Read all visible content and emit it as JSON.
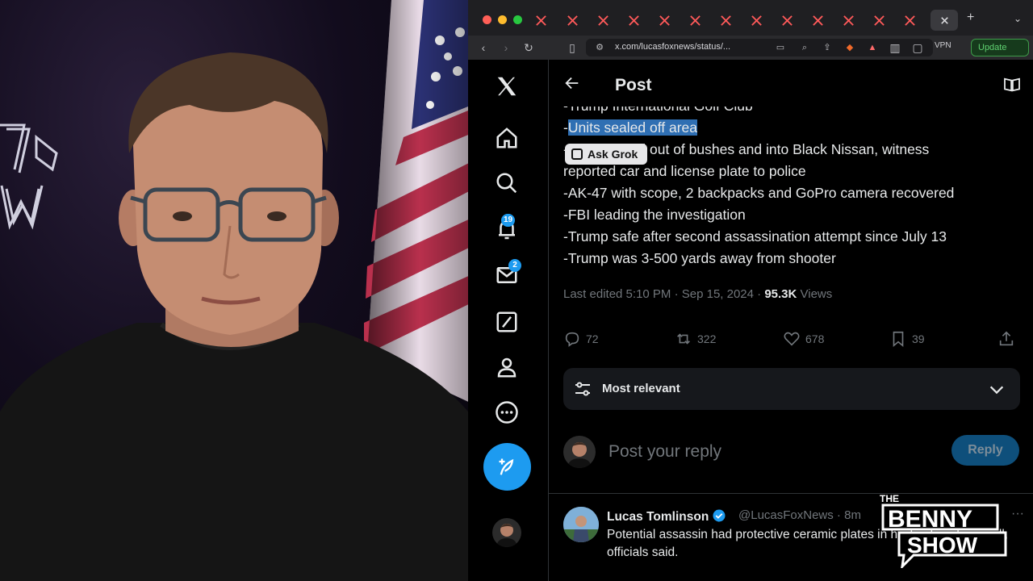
{
  "browser": {
    "url": "x.com/lucasfoxnews/status/...",
    "vpn_label": "VPN",
    "update_label": "Update"
  },
  "nav": {
    "notifications_badge": "19",
    "messages_badge": "2"
  },
  "post": {
    "header_title": "Post",
    "lines": [
      "-Trump International Golf Club",
      "-Units sealed off area",
      "-Suspect fled out of bushes and into Black Nissan, witness",
      "reported car and license plate to police",
      "-AK-47 with scope, 2 backpacks and GoPro camera recovered",
      "-FBI leading the investigation",
      "-Trump safe after second assassination attempt since July 13",
      "-Trump was 3-500 yards away from shooter"
    ],
    "highlighted_text": "Units sealed off area",
    "ask_grok_label": "Ask Grok",
    "edited_time": "Last edited 5:10 PM · Sep 15, 2024 · ",
    "views_count": "95.3K",
    "views_label": " Views",
    "replies": "72",
    "reposts": "322",
    "likes": "678",
    "bookmarks": "39"
  },
  "sort": {
    "label": "Most relevant"
  },
  "composer": {
    "placeholder": "Post your reply",
    "button_label": "Reply"
  },
  "reply": {
    "name": "Lucas Tomlinson",
    "handle": "@LucasFoxNews · 8m",
    "text": "Potential assassin had protective ceramic plates in his backpack as well, officials said."
  },
  "watermark": {
    "line1": "THE",
    "line2": "BENNY",
    "line3": "SHOW"
  },
  "colors": {
    "accent": "#1d9bf0",
    "highlight": "#2f6fb3",
    "muted": "#71767b"
  }
}
